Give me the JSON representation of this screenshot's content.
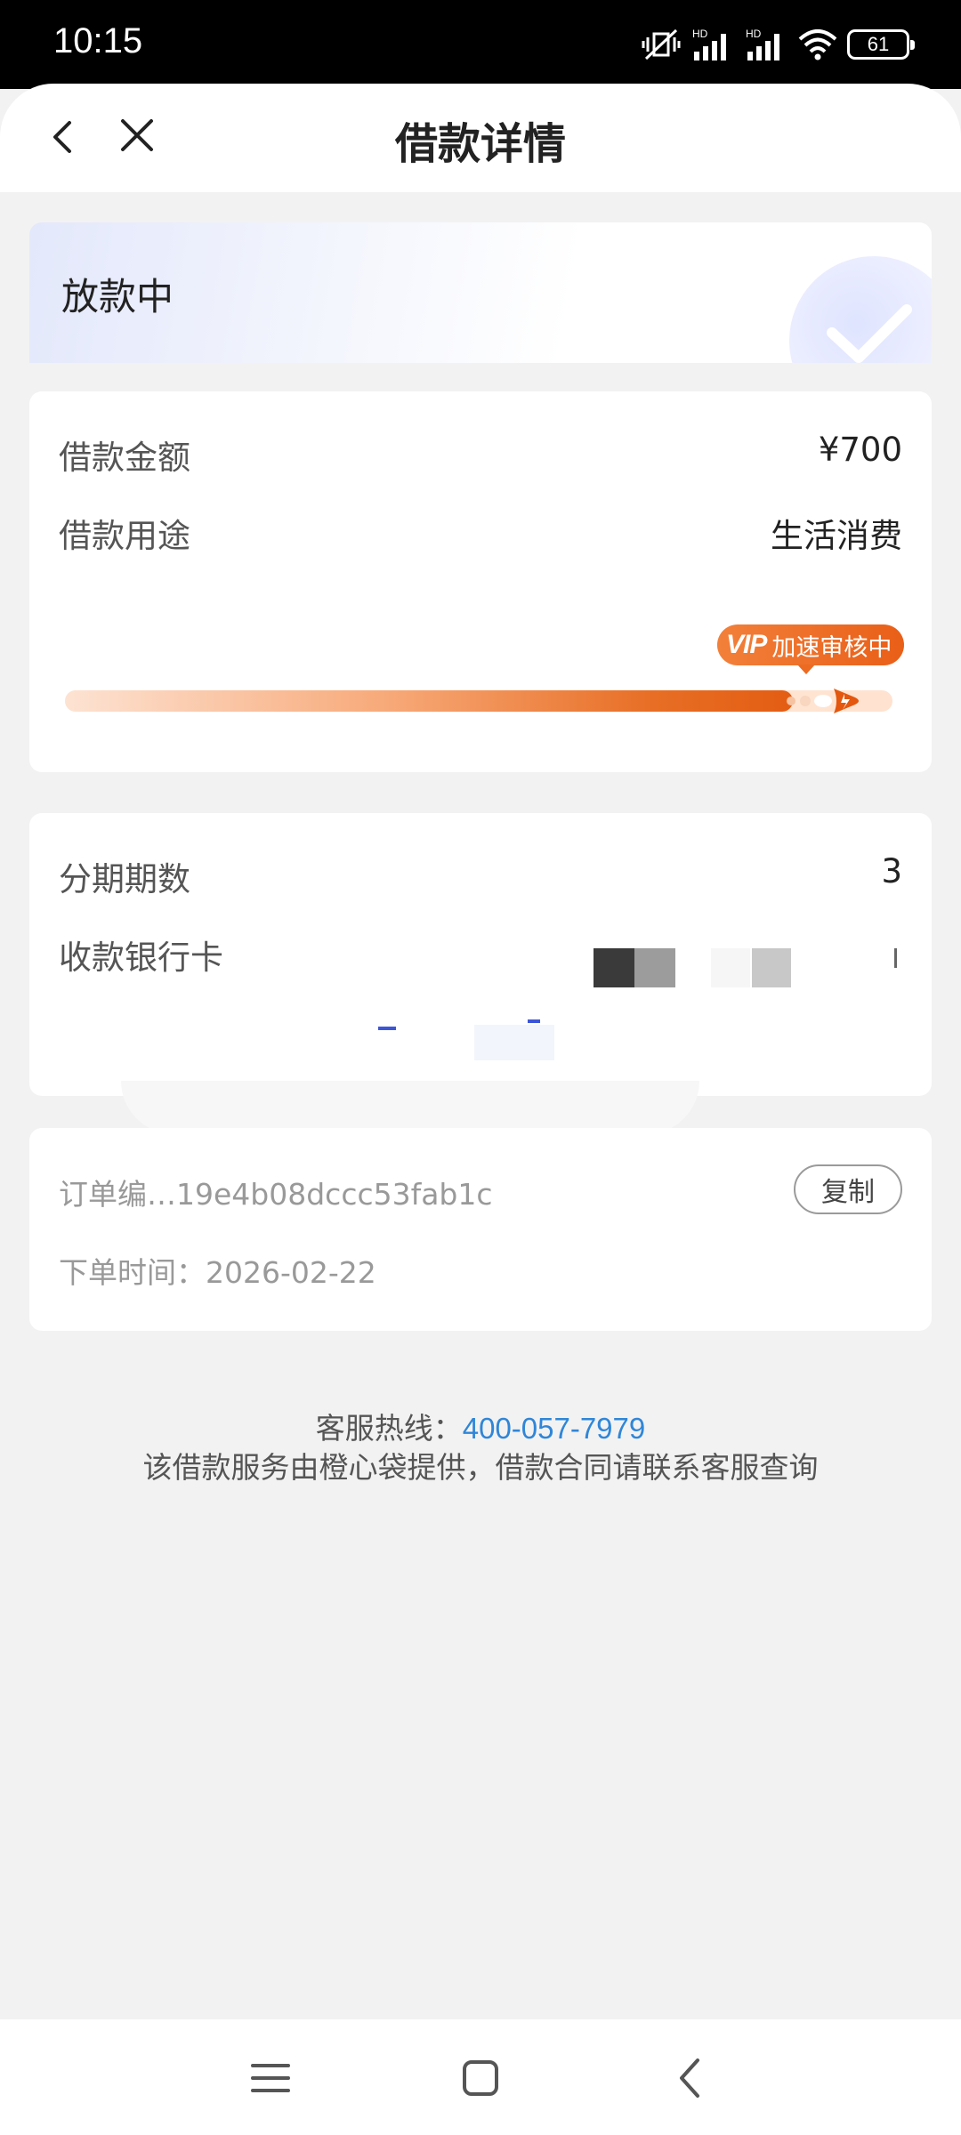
{
  "status_bar": {
    "time": "10:15",
    "battery": "61",
    "signal_label_1": "HD",
    "signal_label_2": "HD"
  },
  "header": {
    "title": "借款详情"
  },
  "status_card": {
    "status": "放款中"
  },
  "amount_card": {
    "amount_label": "借款金额",
    "amount_value": "¥700",
    "purpose_label": "借款用途",
    "purpose_value": "生活消费",
    "badge_vip": "VIP",
    "badge_text": "加速审核中",
    "progress": 0.88
  },
  "installment_card": {
    "periods_label": "分期期数",
    "periods_value": "3",
    "bank_label": "收款银行卡"
  },
  "order_card": {
    "order_no": "订单编…19e4b08dccc53fab1c",
    "copy_label": "复制",
    "order_time": "下单时间：2026-02-22"
  },
  "footer": {
    "hotline_label": "客服热线：",
    "hotline_number": "400-057-7979",
    "provider_note": "该借款服务由橙心袋提供，借款合同请联系客服查询"
  },
  "colors": {
    "accent_orange": "#e95f18",
    "link_blue": "#2f86d8"
  }
}
